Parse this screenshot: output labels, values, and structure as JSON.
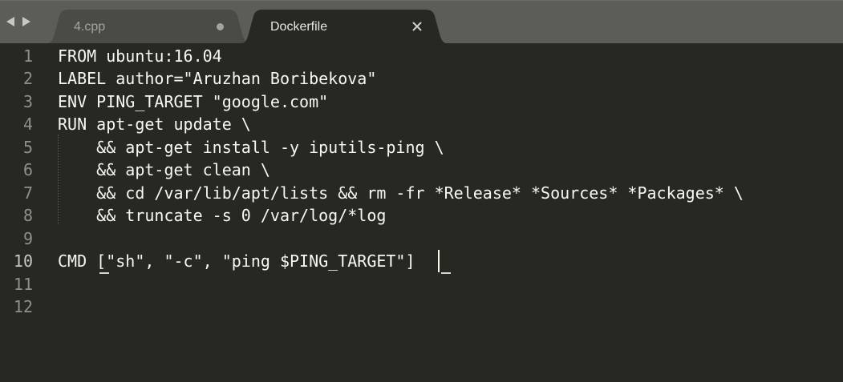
{
  "tabbar": {
    "back_arrow_icon": "triangle-left-icon",
    "forward_arrow_icon": "triangle-right-icon",
    "tabs": [
      {
        "label": "4.cpp",
        "active": false,
        "modified": true
      },
      {
        "label": "Dockerfile",
        "active": true,
        "close_icon": "close-x-icon"
      }
    ]
  },
  "editor": {
    "current_line": 10,
    "lines": [
      {
        "number": "1",
        "text": "FROM ubuntu:16.04"
      },
      {
        "number": "2",
        "text": "LABEL author=\"Aruzhan Boribekova\""
      },
      {
        "number": "3",
        "text": "ENV PING_TARGET \"google.com\""
      },
      {
        "number": "4",
        "text": "RUN apt-get update \\"
      },
      {
        "number": "5",
        "text": "    && apt-get install -y iputils-ping \\"
      },
      {
        "number": "6",
        "text": "    && apt-get clean \\"
      },
      {
        "number": "7",
        "text": "    && cd /var/lib/apt/lists && rm -fr *Release* *Sources* *Packages* \\"
      },
      {
        "number": "8",
        "text": "    && truncate -s 0 /var/log/*log"
      },
      {
        "number": "9",
        "text": ""
      },
      {
        "number": "10",
        "text": "CMD [\"sh\", \"-c\", \"ping $PING_TARGET\"]"
      },
      {
        "number": "11",
        "text": ""
      },
      {
        "number": "12",
        "text": ""
      }
    ]
  },
  "colors": {
    "editor_background": "#272822",
    "tabbar_background": "#5c5d58",
    "active_tab": "#272822",
    "inactive_tab": "#4a4b46",
    "text": "#f8f8f2",
    "gutter_text": "#8f908a"
  }
}
